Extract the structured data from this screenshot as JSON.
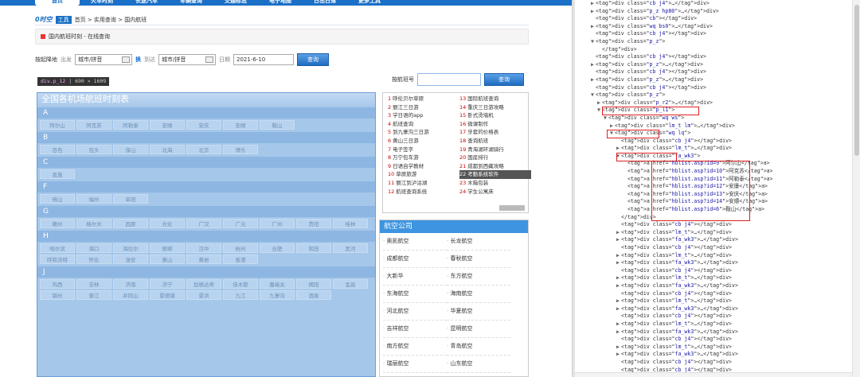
{
  "nav": {
    "items": [
      "首页",
      "火车时刻",
      "长途汽车",
      "车辆查询",
      "交通标志",
      "电子地图",
      "日出日落",
      "更多工具"
    ]
  },
  "breadcrumb": {
    "logo": "0时空",
    "tool": "工具",
    "path": "首页 > 实用查询 > 国内航班"
  },
  "notice": {
    "text": "国内航班时刻 - 在线查询"
  },
  "search": {
    "label": "按起降地",
    "from_label": "出发",
    "from_value": "城市/拼音",
    "swap": "换",
    "to_label": "到达",
    "to_value": "城市/拼音",
    "date_label": "日期",
    "date_value": "2021-6-10",
    "button": "查询"
  },
  "tooltip": {
    "selector": "div.p_12",
    "size": "690 × 1609"
  },
  "flight_no": {
    "label": "按航班号",
    "button": "查询"
  },
  "airport_panel": {
    "title": "全国各机场航班时刻表",
    "groups": [
      {
        "letter": "A",
        "cities": [
          "阿尔山",
          "阿克苏",
          "阿勒泰",
          "安顺",
          "安庆",
          "安顺",
          "鞍山"
        ]
      },
      {
        "letter": "B",
        "cities": [
          "百色",
          "包头",
          "保山",
          "北海",
          "北京",
          "博乐"
        ]
      },
      {
        "letter": "C",
        "cities": [
          "恩施"
        ]
      },
      {
        "letter": "F",
        "cities": [
          "佛山",
          "福州",
          "阜阳"
        ]
      },
      {
        "letter": "G",
        "cities": [
          "赣州",
          "格尔木",
          "固原",
          "光化",
          "广汉",
          "广元",
          "广州",
          "贵阳",
          "桂林"
        ]
      },
      {
        "letter": "H",
        "cities": [
          "哈尔滨",
          "海口",
          "海拉尔",
          "邯郸",
          "汉中",
          "杭州",
          "合肥",
          "和田",
          "黑河",
          "呼和浩特",
          "怀化",
          "淮安",
          "黄山",
          "黄岩",
          "香港"
        ]
      },
      {
        "letter": "J",
        "cities": [
          "鸡西",
          "吉林",
          "济南",
          "济宁",
          "加格达奇",
          "佳木斯",
          "嘉峪关",
          "揭阳",
          "金昌",
          "锦州",
          "晋江",
          "井冈山",
          "景德镇",
          "景洪",
          "九江",
          "九寨沟",
          "酒泉"
        ]
      }
    ]
  },
  "hot_list": {
    "items": [
      {
        "n": "1",
        "t": "呼伦贝尔草原"
      },
      {
        "n": "13",
        "t": "国际航班查询"
      },
      {
        "n": "2",
        "t": "丽江三日游"
      },
      {
        "n": "14",
        "t": "重庆三日游攻略"
      },
      {
        "n": "3",
        "t": "学日语的app"
      },
      {
        "n": "15",
        "t": "卧式烫墙机"
      },
      {
        "n": "4",
        "t": "航班查询"
      },
      {
        "n": "16",
        "t": "微课制作"
      },
      {
        "n": "5",
        "t": "到九寨沟三日游"
      },
      {
        "n": "17",
        "t": "牙套的价格表"
      },
      {
        "n": "6",
        "t": "黄山三日游"
      },
      {
        "n": "18",
        "t": "查询航班"
      },
      {
        "n": "7",
        "t": "电子签字"
      },
      {
        "n": "19",
        "t": "青海湖环湖骑行"
      },
      {
        "n": "8",
        "t": "万宁包车游"
      },
      {
        "n": "20",
        "t": "国産排行"
      },
      {
        "n": "9",
        "t": "日语自学教材"
      },
      {
        "n": "21",
        "t": "成都到西藏攻略"
      },
      {
        "n": "10",
        "t": "草原旅游"
      },
      {
        "n": "22",
        "t": "考勤系统软件"
      },
      {
        "n": "11",
        "t": "丽江到泸沽湖"
      },
      {
        "n": "23",
        "t": "木箱包装"
      },
      {
        "n": "12",
        "t": "航班查询系统"
      },
      {
        "n": "24",
        "t": "学生公寓床"
      }
    ]
  },
  "airlines": {
    "title": "航空公司",
    "items": [
      "奥凯航空",
      "长龙航空",
      "成都航空",
      "春秋航空",
      "大新华",
      "东方航空",
      "东海航空",
      "海南航空",
      "河北航空",
      "华夏航空",
      "吉祥航空",
      "昆明航空",
      "南方航空",
      "青岛航空",
      "瑞丽航空",
      "山东航空",
      "上海航空",
      "深圳航空"
    ]
  },
  "devtools": {
    "lines": [
      {
        "i": 0,
        "t": "▶",
        "h": "<div class=\"cb j4\">…</div>"
      },
      {
        "i": 0,
        "t": "▶",
        "h": "<div class=\"p_z hp80\">…</div>"
      },
      {
        "i": 0,
        "t": "",
        "h": "<div class=\"cb\"></div>"
      },
      {
        "i": 0,
        "t": "▶",
        "h": "<div class=\"wq bs0\">…</div>"
      },
      {
        "i": 0,
        "t": "",
        "h": "<div class=\"cb j4\"></div>"
      },
      {
        "i": 0,
        "t": "▼",
        "h": "<div class=\"p_z\">"
      },
      {
        "i": 1,
        "t": "",
        "h": "</div>"
      },
      {
        "i": 0,
        "t": "",
        "h": "<div class=\"cb j4\"></div>"
      },
      {
        "i": 0,
        "t": "▶",
        "h": "<div class=\"p_z\">…</div>"
      },
      {
        "i": 0,
        "t": "",
        "h": "<div class=\"cb j4\"></div>"
      },
      {
        "i": 0,
        "t": "▶",
        "h": "<div class=\"p_z\">…</div>"
      },
      {
        "i": 0,
        "t": "",
        "h": "<div class=\"cb j4\"></div>"
      },
      {
        "i": 0,
        "t": "▼",
        "h": "<div class=\"p_z\">"
      },
      {
        "i": 1,
        "t": "▶",
        "h": "<div class=\"p_r2\">…</div>"
      },
      {
        "i": 1,
        "t": "▼",
        "h": "<div class=\"p_l1\">"
      },
      {
        "i": 2,
        "t": "▼",
        "h": "<div class=\"wq ws\">"
      },
      {
        "i": 3,
        "t": "▶",
        "h": "<div class=\"lm_t lm\">…</div>"
      },
      {
        "i": 3,
        "t": "▼",
        "h": "<div class=\"wq lq\">"
      },
      {
        "i": 4,
        "t": "",
        "h": "<div class=\"cb j4\"></div>"
      },
      {
        "i": 4,
        "t": "▶",
        "h": "<div class=\"lm_t\">…</div>"
      },
      {
        "i": 4,
        "t": "▼",
        "h": "<div class=\"fa_wk3\">"
      },
      {
        "i": 5,
        "t": "",
        "h": "<a href=\"hblist.asp?id=9\">阿尔山</a>"
      },
      {
        "i": 5,
        "t": "",
        "h": "<a href=\"hblist.asp?id=10\">阿克苏</a>"
      },
      {
        "i": 5,
        "t": "",
        "h": "<a href=\"hblist.asp?id=11\">阿勒泰</a>"
      },
      {
        "i": 5,
        "t": "",
        "h": "<a href=\"hblist.asp?id=12\">安康</a>"
      },
      {
        "i": 5,
        "t": "",
        "h": "<a href=\"hblist.asp?id=13\">安庆</a>"
      },
      {
        "i": 5,
        "t": "",
        "h": "<a href=\"hblist.asp?id=14\">安顺</a>"
      },
      {
        "i": 5,
        "t": "",
        "h": "<a href=\"hblist.asp?id=6\">鞍山</a>"
      },
      {
        "i": 4,
        "t": "",
        "h": "</div>"
      },
      {
        "i": 4,
        "t": "",
        "h": "<div class=\"cb j4\"></div>"
      },
      {
        "i": 4,
        "t": "▶",
        "h": "<div class=\"lm_t\">…</div>"
      },
      {
        "i": 4,
        "t": "▶",
        "h": "<div class=\"fa_wk3\">…</div>"
      },
      {
        "i": 4,
        "t": "",
        "h": "<div class=\"cb j4\"></div>"
      },
      {
        "i": 4,
        "t": "▶",
        "h": "<div class=\"lm_t\">…</div>"
      },
      {
        "i": 4,
        "t": "▶",
        "h": "<div class=\"fa_wk3\">…</div>"
      },
      {
        "i": 4,
        "t": "",
        "h": "<div class=\"cb j4\"></div>"
      },
      {
        "i": 4,
        "t": "▶",
        "h": "<div class=\"lm_t\">…</div>"
      },
      {
        "i": 4,
        "t": "▶",
        "h": "<div class=\"fa_wk3\">…</div>"
      },
      {
        "i": 4,
        "t": "",
        "h": "<div class=\"cb j4\"></div>"
      },
      {
        "i": 4,
        "t": "▶",
        "h": "<div class=\"lm_t\">…</div>"
      },
      {
        "i": 4,
        "t": "▶",
        "h": "<div class=\"fa_wk3\">…</div>"
      },
      {
        "i": 4,
        "t": "",
        "h": "<div class=\"cb j4\"></div>"
      },
      {
        "i": 4,
        "t": "▶",
        "h": "<div class=\"lm_t\">…</div>"
      },
      {
        "i": 4,
        "t": "▶",
        "h": "<div class=\"fa_wk3\">…</div>"
      },
      {
        "i": 4,
        "t": "",
        "h": "<div class=\"cb j4\"></div>"
      },
      {
        "i": 4,
        "t": "▶",
        "h": "<div class=\"lm_t\">…</div>"
      },
      {
        "i": 4,
        "t": "▶",
        "h": "<div class=\"fa_wk3\">…</div>"
      },
      {
        "i": 4,
        "t": "",
        "h": "<div class=\"cb j4\"></div>"
      },
      {
        "i": 4,
        "t": "",
        "h": "<div class=\"cb j4\"></div>"
      }
    ]
  }
}
